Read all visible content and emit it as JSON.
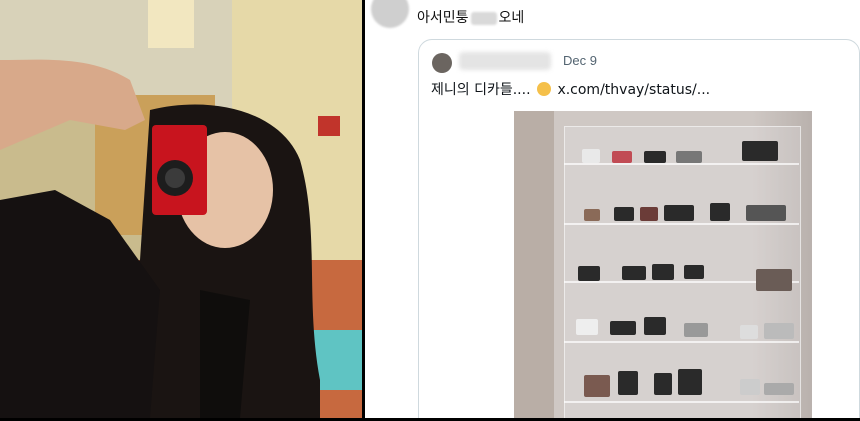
{
  "left_photo": {},
  "reply": {
    "author_visible": "아서민퉁",
    "author_suffix": "오네"
  },
  "quoted_post": {
    "date": "Dec 9",
    "text": "제니의 디카들.... ",
    "link": "x.com/thvay/status/..."
  }
}
